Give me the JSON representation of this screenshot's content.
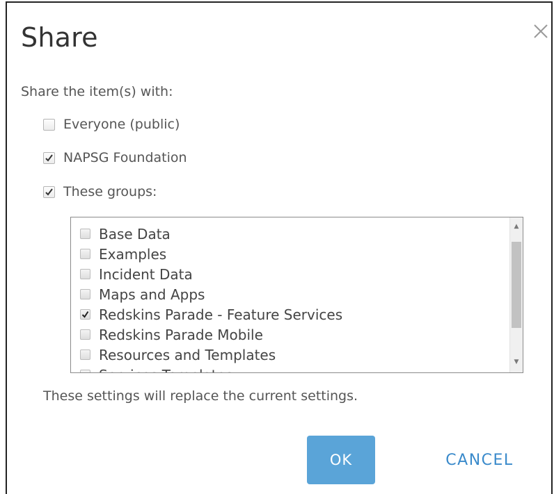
{
  "dialog": {
    "title": "Share",
    "close_icon": "close-icon",
    "share_label": "Share the item(s) with:",
    "options": [
      {
        "label": "Everyone (public)",
        "checked": false
      },
      {
        "label": "NAPSG Foundation",
        "checked": true
      },
      {
        "label": "These groups:",
        "checked": true
      }
    ],
    "groups": [
      {
        "label": "Base Data",
        "checked": false
      },
      {
        "label": "Examples",
        "checked": false
      },
      {
        "label": "Incident Data",
        "checked": false
      },
      {
        "label": "Maps and Apps",
        "checked": false
      },
      {
        "label": "Redskins Parade - Feature Services",
        "checked": true
      },
      {
        "label": "Redskins Parade Mobile",
        "checked": false
      },
      {
        "label": "Resources and Templates",
        "checked": false
      },
      {
        "label": "Services Templates",
        "checked": false
      }
    ],
    "note": "These settings will replace the current settings.",
    "ok_label": "OK",
    "cancel_label": "CANCEL"
  },
  "colors": {
    "accent": "#5aa4d8",
    "link": "#3a8acb",
    "text": "#555555"
  }
}
